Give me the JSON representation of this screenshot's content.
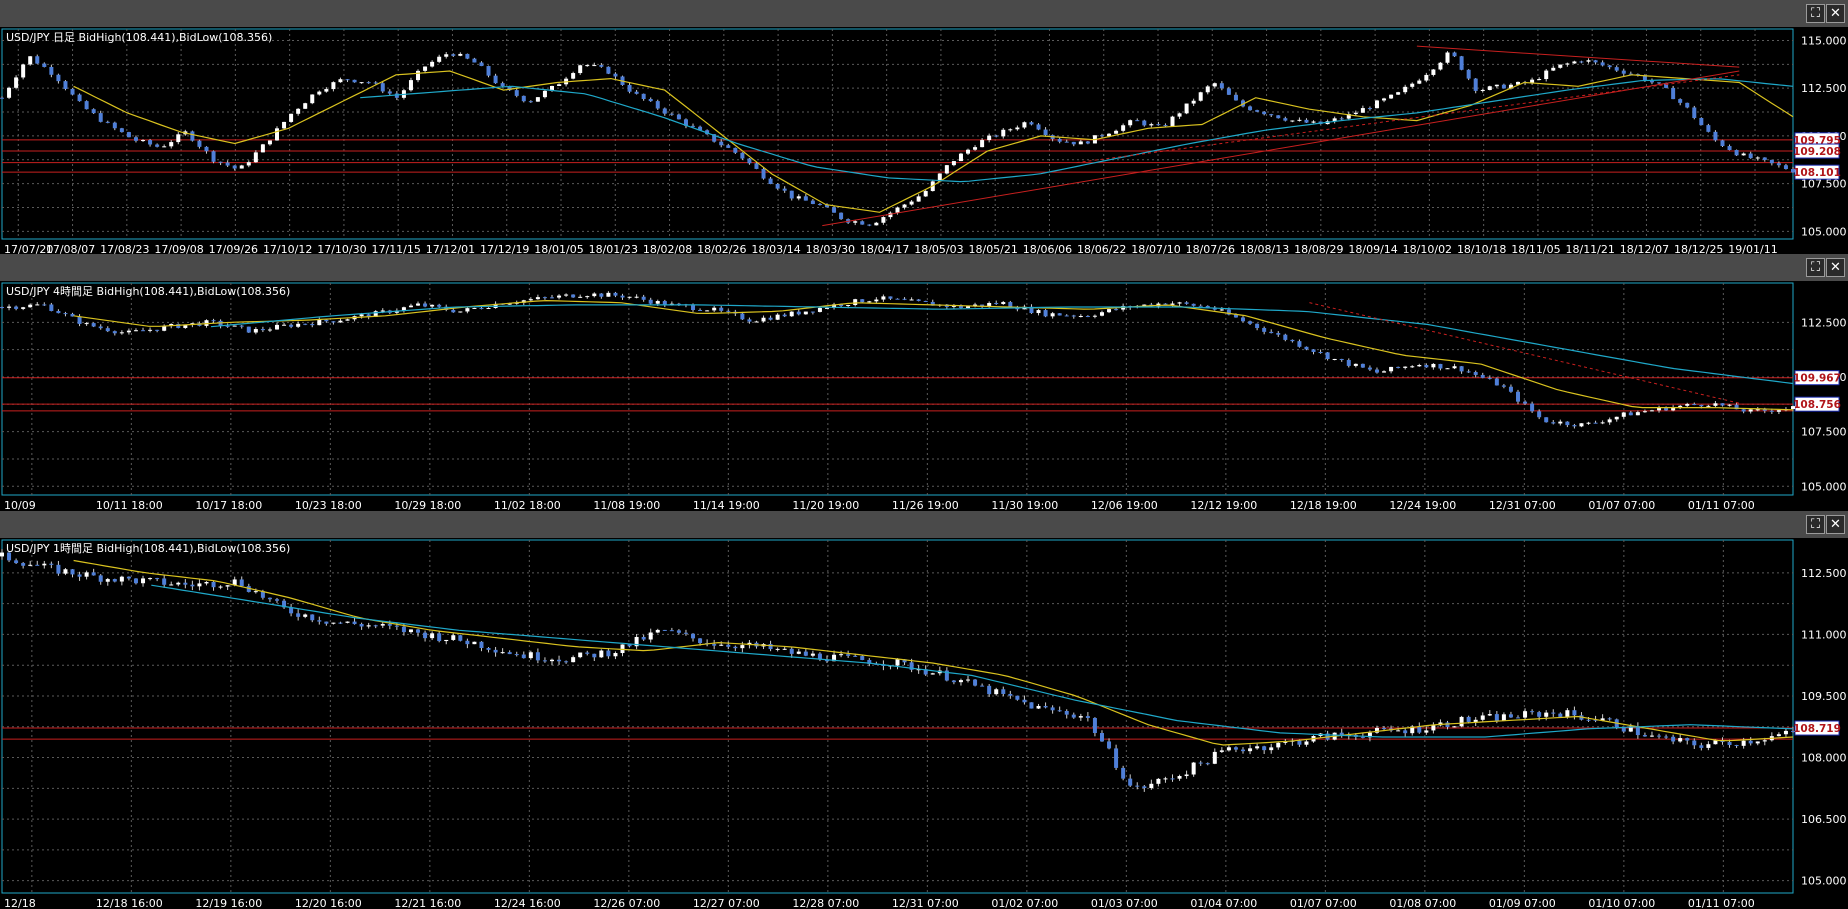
{
  "panels": [
    {
      "id": "daily",
      "title": "USD/JPY 日足  BidHigh(108.441),BidLow(108.356)",
      "buttons": {
        "maximize": "⛶",
        "close": "✕"
      },
      "chart_data": {
        "type": "candlestick",
        "instrument": "USD/JPY",
        "timeframe": "日足",
        "bid_high": 108.441,
        "bid_low": 108.356,
        "x_ticks": [
          "17/07/20",
          "17/08/07",
          "17/08/23",
          "17/09/08",
          "17/09/26",
          "17/10/12",
          "17/10/30",
          "17/11/15",
          "17/12/01",
          "17/12/19",
          "18/01/05",
          "18/01/23",
          "18/02/08",
          "18/02/26",
          "18/03/14",
          "18/03/30",
          "18/04/17",
          "18/05/03",
          "18/05/21",
          "18/06/06",
          "18/06/22",
          "18/07/10",
          "18/07/26",
          "18/08/13",
          "18/08/29",
          "18/09/14",
          "18/10/02",
          "18/10/18",
          "18/11/05",
          "18/11/21",
          "18/12/07",
          "18/12/25",
          "19/01/11"
        ],
        "y_ticks": [
          "115.000",
          "112.500",
          "110.000",
          "107.500",
          "105.000"
        ],
        "ylim": [
          104.6,
          115.6
        ],
        "price_path": [
          112.0,
          114.2,
          113.2,
          111.6,
          110.6,
          109.8,
          109.4,
          110.2,
          108.8,
          108.2,
          109.6,
          111.2,
          112.4,
          113.0,
          112.8,
          112.0,
          113.6,
          114.4,
          113.8,
          112.5,
          111.8,
          112.6,
          113.8,
          113.4,
          112.2,
          111.4,
          110.6,
          109.8,
          109.0,
          107.8,
          106.8,
          106.4,
          105.6,
          105.4,
          106.2,
          107.0,
          108.6,
          109.6,
          110.2,
          110.8,
          109.8,
          109.6,
          110.2,
          110.8,
          110.4,
          111.6,
          112.8,
          111.6,
          111.2,
          110.8,
          110.6,
          111.0,
          111.6,
          112.2,
          113.2,
          114.4,
          112.4,
          112.6,
          112.8,
          113.6,
          114.0,
          113.6,
          113.2,
          112.6,
          111.4,
          109.8,
          109.0,
          108.6,
          108.2
        ],
        "ma_fast_path": [
          112.6,
          111.2,
          110.2,
          109.6,
          110.4,
          111.8,
          113.2,
          113.4,
          112.4,
          112.8,
          113.0,
          112.4,
          110.2,
          108.0,
          106.4,
          106.0,
          107.4,
          109.2,
          110.0,
          109.8,
          110.4,
          110.6,
          112.0,
          111.4,
          111.0,
          110.8,
          111.6,
          112.8,
          112.6,
          113.2,
          113.0,
          112.8,
          111.0
        ],
        "ma_slow_path": [
          112.0,
          112.3,
          112.6,
          112.2,
          111.0,
          109.6,
          108.4,
          107.8,
          107.6,
          108.0,
          108.8,
          109.6,
          110.3,
          110.8,
          111.2,
          111.8,
          112.4,
          112.9,
          113.0,
          112.6
        ],
        "ma_slow_start_index": 12,
        "horizontal_lines": [
          {
            "value": 109.795,
            "label": "109.795"
          },
          {
            "value": 109.208,
            "label": "109.208"
          },
          {
            "value": 108.6,
            "label": ""
          },
          {
            "value": 108.101,
            "label": "108.101"
          }
        ],
        "trendlines": [
          {
            "from": [
              0.458,
              105.3
            ],
            "to": [
              0.97,
              113.4
            ],
            "dashed": false
          },
          {
            "from": [
              0.79,
              114.7
            ],
            "to": [
              0.97,
              113.6
            ],
            "dashed": false
          },
          {
            "from": [
              0.6,
              108.6
            ],
            "to": [
              0.97,
              113.2
            ],
            "dashed": true
          }
        ]
      }
    },
    {
      "id": "h4",
      "title": "USD/JPY 4時間足  BidHigh(108.441),BidLow(108.356)",
      "buttons": {
        "maximize": "⛶",
        "close": "✕"
      },
      "chart_data": {
        "type": "candlestick",
        "instrument": "USD/JPY",
        "timeframe": "4時間足",
        "bid_high": 108.441,
        "bid_low": 108.356,
        "x_ticks": [
          "10/09",
          "10/11 18:00",
          "10/17 18:00",
          "10/23 18:00",
          "10/29 18:00",
          "11/02 18:00",
          "11/08 19:00",
          "11/14 19:00",
          "11/20 19:00",
          "11/26 19:00",
          "11/30 19:00",
          "12/06 19:00",
          "12/12 19:00",
          "12/18 19:00",
          "12/24 19:00",
          "12/31 07:00",
          "01/07 07:00",
          "01/11 07:00"
        ],
        "y_ticks": [
          "112.500",
          "110.000",
          "107.500",
          "105.000"
        ],
        "ylim": [
          104.6,
          114.3
        ],
        "price_path": [
          113.2,
          113.3,
          112.4,
          112.0,
          112.3,
          112.5,
          112.1,
          112.4,
          112.6,
          112.9,
          113.3,
          113.0,
          113.4,
          113.6,
          113.8,
          113.7,
          113.3,
          113.1,
          112.6,
          112.9,
          113.3,
          113.6,
          113.4,
          113.2,
          113.4,
          112.9,
          112.8,
          113.2,
          113.4,
          113.2,
          112.4,
          111.6,
          110.8,
          110.2,
          110.6,
          110.4,
          109.6,
          108.0,
          107.8,
          108.3,
          108.6,
          108.8,
          108.4,
          108.6
        ],
        "ma_fast_path": [
          112.8,
          112.3,
          112.5,
          112.6,
          112.8,
          113.2,
          113.5,
          113.4,
          112.9,
          113.0,
          113.4,
          113.3,
          113.2,
          113.1,
          113.3,
          112.8,
          111.8,
          111.0,
          110.6,
          109.4,
          108.6,
          108.6,
          108.5
        ],
        "ma_slow_path": [
          112.3,
          112.8,
          113.2,
          113.3,
          113.3,
          113.2,
          113.1,
          113.2,
          113.2,
          113.0,
          112.4,
          111.4,
          110.4,
          109.7
        ],
        "ma_slow_start_index": 7,
        "horizontal_lines": [
          {
            "value": 109.967,
            "label": "109.967"
          },
          {
            "value": 108.756,
            "label": "108.756"
          },
          {
            "value": 108.45,
            "label": ""
          }
        ],
        "trendlines": [
          {
            "from": [
              0.73,
              113.4
            ],
            "to": [
              0.97,
              108.8
            ],
            "dashed": true
          }
        ]
      }
    },
    {
      "id": "h1",
      "title": "USD/JPY 1時間足  BidHigh(108.441),BidLow(108.356)",
      "buttons": {
        "maximize": "⛶",
        "close": "✕"
      },
      "chart_data": {
        "type": "candlestick",
        "instrument": "USD/JPY",
        "timeframe": "1時間足",
        "bid_high": 108.441,
        "bid_low": 108.356,
        "x_ticks": [
          "12/18",
          "12/18 16:00",
          "12/19 16:00",
          "12/20 16:00",
          "12/21 16:00",
          "12/24 16:00",
          "12/26 07:00",
          "12/27 07:00",
          "12/28 07:00",
          "12/31 07:00",
          "01/02 07:00",
          "01/03 07:00",
          "01/04 07:00",
          "01/07 07:00",
          "01/08 07:00",
          "01/09 07:00",
          "01/10 07:00",
          "01/11 07:00"
        ],
        "y_ticks": [
          "112.500",
          "111.000",
          "109.500",
          "108.000",
          "106.500",
          "105.000"
        ],
        "ylim": [
          104.7,
          113.3
        ],
        "price_path": [
          112.9,
          112.6,
          112.4,
          112.3,
          112.2,
          112.3,
          111.6,
          111.3,
          111.2,
          111.0,
          110.8,
          110.5,
          110.4,
          110.6,
          111.1,
          110.8,
          110.7,
          110.5,
          110.4,
          110.3,
          110.0,
          109.6,
          109.2,
          109.0,
          107.2,
          107.6,
          108.2,
          108.3,
          108.5,
          108.6,
          108.7,
          108.9,
          109.0,
          109.1,
          108.9,
          108.5,
          108.3,
          108.4,
          108.6
        ],
        "ma_fast_path": [
          112.8,
          112.5,
          112.3,
          111.9,
          111.4,
          111.1,
          110.9,
          110.7,
          110.6,
          110.8,
          110.7,
          110.5,
          110.3,
          110.0,
          109.5,
          108.8,
          108.3,
          108.4,
          108.6,
          108.8,
          108.9,
          109.0,
          108.7,
          108.4,
          108.5
        ],
        "ma_slow_path": [
          112.2,
          111.8,
          111.4,
          111.1,
          110.9,
          110.7,
          110.5,
          110.3,
          110.0,
          109.4,
          108.9,
          108.6,
          108.5,
          108.5,
          108.7,
          108.8,
          108.7
        ],
        "ma_slow_start_index": 5,
        "horizontal_lines": [
          {
            "value": 108.719,
            "label": "108.719"
          },
          {
            "value": 108.45,
            "label": ""
          }
        ],
        "trendlines": []
      }
    }
  ],
  "colors": {
    "background": "#000000",
    "grid": "#5a5a5a",
    "candle_bull": "#ffffff",
    "candle_bear": "#4f7fd8",
    "ma_fast": "#d9c21f",
    "ma_slow": "#1fa8c9",
    "hline": "#c8201f",
    "text": "#ffffff"
  }
}
